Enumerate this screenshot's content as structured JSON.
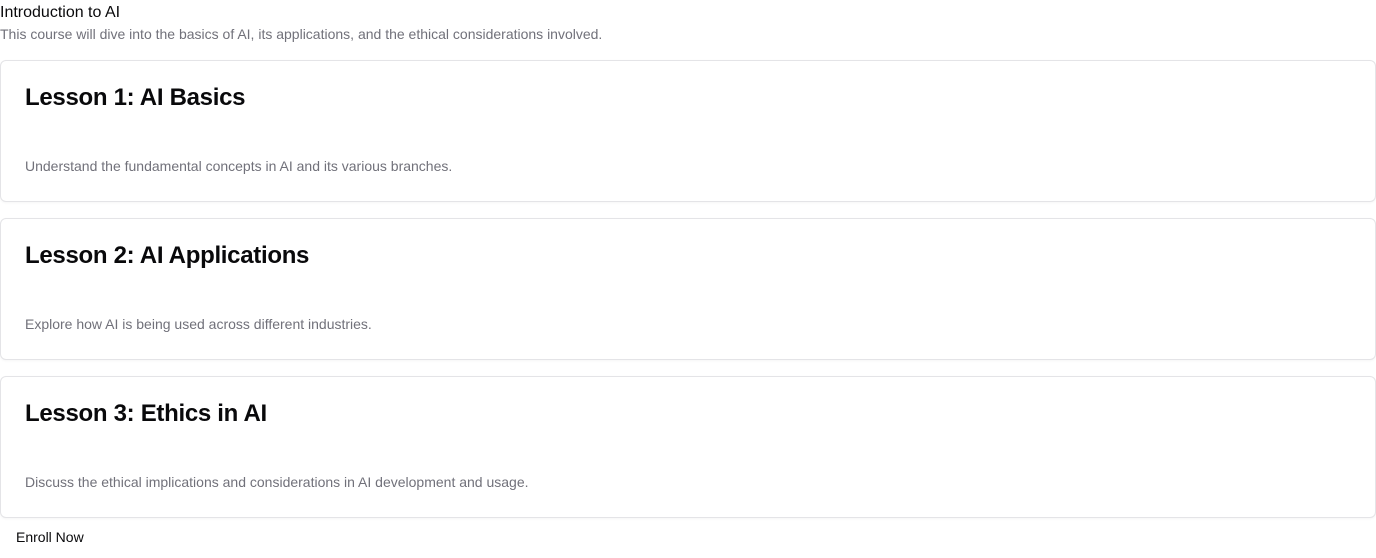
{
  "course": {
    "title": "Introduction to AI",
    "description": "This course will dive into the basics of AI, its applications, and the ethical considerations involved."
  },
  "lessons": [
    {
      "title": "Lesson 1: AI Basics",
      "description": "Understand the fundamental concepts in AI and its various branches."
    },
    {
      "title": "Lesson 2: AI Applications",
      "description": "Explore how AI is being used across different industries."
    },
    {
      "title": "Lesson 3: Ethics in AI",
      "description": "Discuss the ethical implications and considerations in AI development and usage."
    }
  ],
  "actions": {
    "enroll_label": "Enroll Now"
  },
  "colors": {
    "text_primary": "#09090b",
    "text_muted": "#71717a",
    "card_border": "#e4e4e7"
  }
}
